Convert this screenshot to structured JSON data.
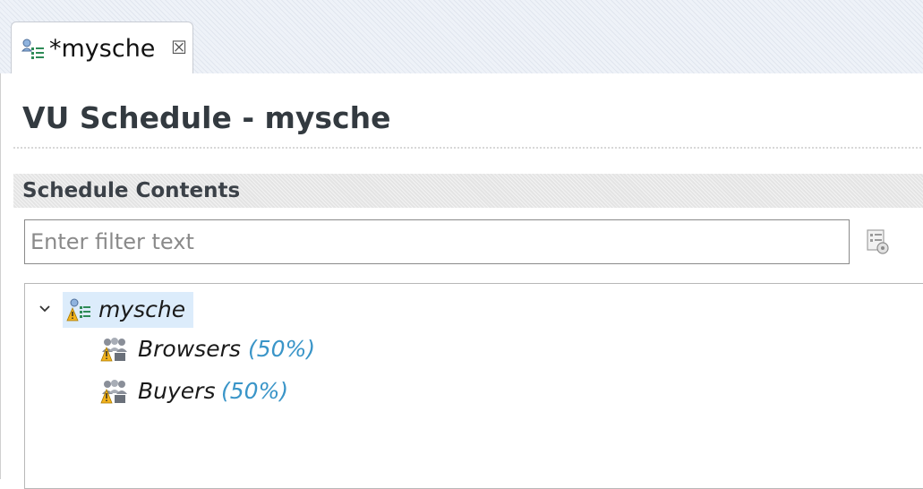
{
  "tab": {
    "label": "*mysche",
    "icon": "schedule-icon",
    "close_icon": "close-icon"
  },
  "editor": {
    "title": "VU Schedule - mysche"
  },
  "section": {
    "title": "Schedule Contents"
  },
  "filter": {
    "placeholder": "Enter filter text",
    "value": "",
    "button_icon": "filter-options-icon"
  },
  "tree": {
    "root": {
      "label": "mysche",
      "icon": "schedule-warning-icon",
      "expanded": true,
      "selected": true
    },
    "children": [
      {
        "label": "Browsers",
        "percent": "(50%)",
        "icon": "user-group-warning-icon"
      },
      {
        "label": "Buyers",
        "percent": "(50%)",
        "icon": "user-group-warning-icon"
      }
    ]
  },
  "colors": {
    "percent": "#3a95c8",
    "selection": "#dcecfb",
    "warning": "#f2b21c"
  }
}
